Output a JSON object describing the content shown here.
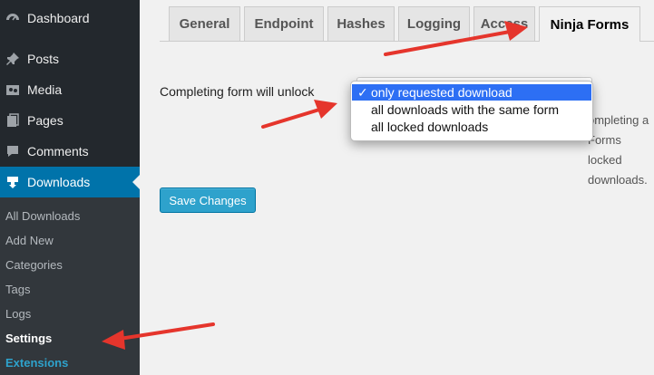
{
  "sidebar": {
    "items": [
      {
        "label": "Dashboard",
        "icon": "dashboard-icon"
      },
      {
        "label": "Posts",
        "icon": "pin-icon"
      },
      {
        "label": "Media",
        "icon": "media-icon"
      },
      {
        "label": "Pages",
        "icon": "pages-icon"
      },
      {
        "label": "Comments",
        "icon": "comments-icon"
      },
      {
        "label": "Downloads",
        "icon": "download-icon"
      }
    ],
    "submenu": [
      "All Downloads",
      "Add New",
      "Categories",
      "Tags",
      "Logs",
      "Settings",
      "Extensions"
    ],
    "current_submenu": "Settings"
  },
  "tabs": [
    {
      "label": "General"
    },
    {
      "label": "Endpoint"
    },
    {
      "label": "Hashes"
    },
    {
      "label": "Logging"
    },
    {
      "label": "Access"
    },
    {
      "label": "Ninja Forms",
      "active": true
    }
  ],
  "form": {
    "label": "Completing form will unlock",
    "selected": "only requested download",
    "options": [
      "only requested download",
      "all downloads with the same form",
      "all locked downloads"
    ],
    "description": "ompleting a Forms locked downloads."
  },
  "save_button": "Save Changes",
  "colors": {
    "sidebar_bg": "#23282d",
    "submenu_bg": "#32373c",
    "active_blue": "#0073aa",
    "button_blue": "#2ea2cc",
    "arrow_red": "#e5352c",
    "select_highlight": "#2d6ff4"
  }
}
